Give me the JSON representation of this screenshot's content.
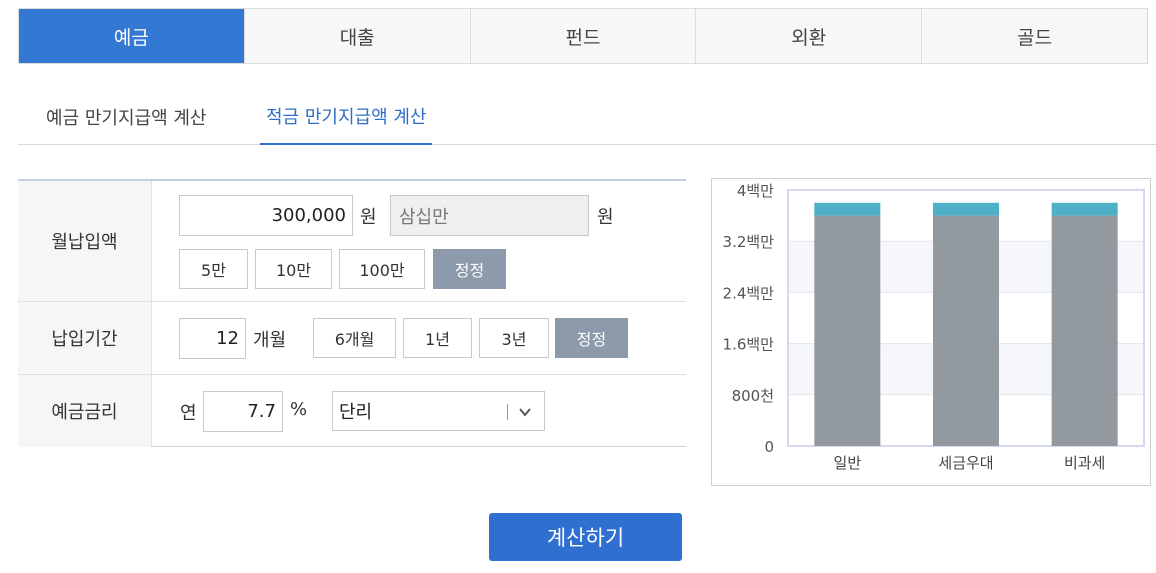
{
  "top_tabs": [
    {
      "label": "예금",
      "active": true
    },
    {
      "label": "대출",
      "active": false
    },
    {
      "label": "펀드",
      "active": false
    },
    {
      "label": "외환",
      "active": false
    },
    {
      "label": "골드",
      "active": false
    }
  ],
  "sub_tabs": [
    {
      "label": "예금 만기지급액 계산",
      "active": false
    },
    {
      "label": "적금 만기지급액 계산",
      "active": true
    }
  ],
  "monthly": {
    "label": "월납입액",
    "amount_value": "300,000",
    "unit": "원",
    "korean_value": "삼십만",
    "unit2": "원",
    "quick_buttons": [
      "5만",
      "10만",
      "100만"
    ],
    "correct_label": "정정"
  },
  "period": {
    "label": "납입기간",
    "months_value": "12",
    "unit": "개월",
    "quick_buttons": [
      "6개월",
      "1년",
      "3년"
    ],
    "correct_label": "정정"
  },
  "rate": {
    "label": "예금금리",
    "prefix": "연",
    "value": "7.7",
    "unit": "%",
    "interest_type": "단리"
  },
  "calc_button": "계산하기",
  "colors": {
    "accent": "#3379d4",
    "principal_bar": "#939a9f",
    "interest_bar": "#4eb0c6"
  },
  "chart_data": {
    "type": "bar",
    "stacked": true,
    "categories": [
      "일반",
      "세금우대",
      "비과세"
    ],
    "series": [
      {
        "values": [
          3600000,
          3600000,
          3600000
        ]
      },
      {
        "values": [
          200000,
          200000,
          200000
        ]
      }
    ],
    "ylim": [
      0,
      4000000
    ],
    "ytick_labels": [
      "0",
      "800천",
      "1.6백만",
      "2.4백만",
      "3.2백만",
      "4백만"
    ],
    "grid": true,
    "legend": "none"
  }
}
